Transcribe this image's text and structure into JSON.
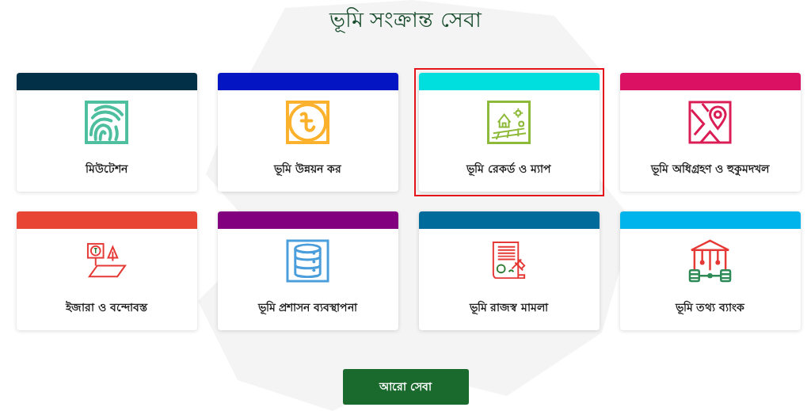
{
  "title": "ভূমি সংক্রান্ত সেবা",
  "services": [
    {
      "label": "মিউটেশন",
      "color": "#023047",
      "kind": "fingerprint",
      "selected": false
    },
    {
      "label": "ভূমি উন্নয়ন কর",
      "color": "#0416c4",
      "kind": "taka",
      "selected": false
    },
    {
      "label": "ভূমি রেকর্ড ও ম্যাপ",
      "color": "#00dede",
      "kind": "landscape",
      "selected": true
    },
    {
      "label": "ভূমি অধিগ্রহণ ও হুকুমদখল",
      "color": "#db1164",
      "kind": "map",
      "selected": false
    },
    {
      "label": "ইজারা ও বন্দোবস্ত",
      "color": "#e84534",
      "kind": "lease",
      "selected": false
    },
    {
      "label": "ভূমি প্রশাসন ব্যবস্থাপনা",
      "color": "#820080",
      "kind": "database",
      "selected": false
    },
    {
      "label": "ভূমি রাজস্ব মামলা",
      "color": "#016b9c",
      "kind": "court",
      "selected": false
    },
    {
      "label": "ভূমি তথ্য ব্যাংক",
      "color": "#02b4ec",
      "kind": "bank",
      "selected": false
    }
  ],
  "more_button": "আরো সেবা"
}
